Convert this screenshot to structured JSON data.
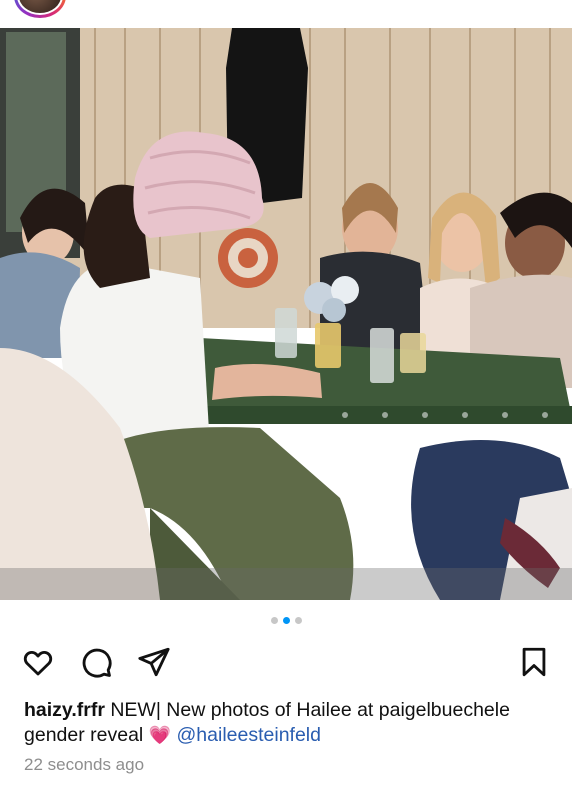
{
  "post": {
    "username": "haizy.frfr",
    "caption_text": "NEW| New photos of Hailee at paigelbuechele gender reveal",
    "emoji": "💗",
    "mention": "@haileesteinfeld",
    "timestamp": "22 seconds ago"
  },
  "carousel": {
    "total": 3,
    "active_index": 1
  },
  "icons": {
    "like": "heart-outline-icon",
    "comment": "comment-bubble-icon",
    "share": "paper-plane-icon",
    "save": "bookmark-outline-icon"
  },
  "colors": {
    "accent": "#0095f6",
    "inactive_dot": "#c7c7c7",
    "mention": "#2a5db0",
    "timestamp": "#8e8e8e"
  }
}
